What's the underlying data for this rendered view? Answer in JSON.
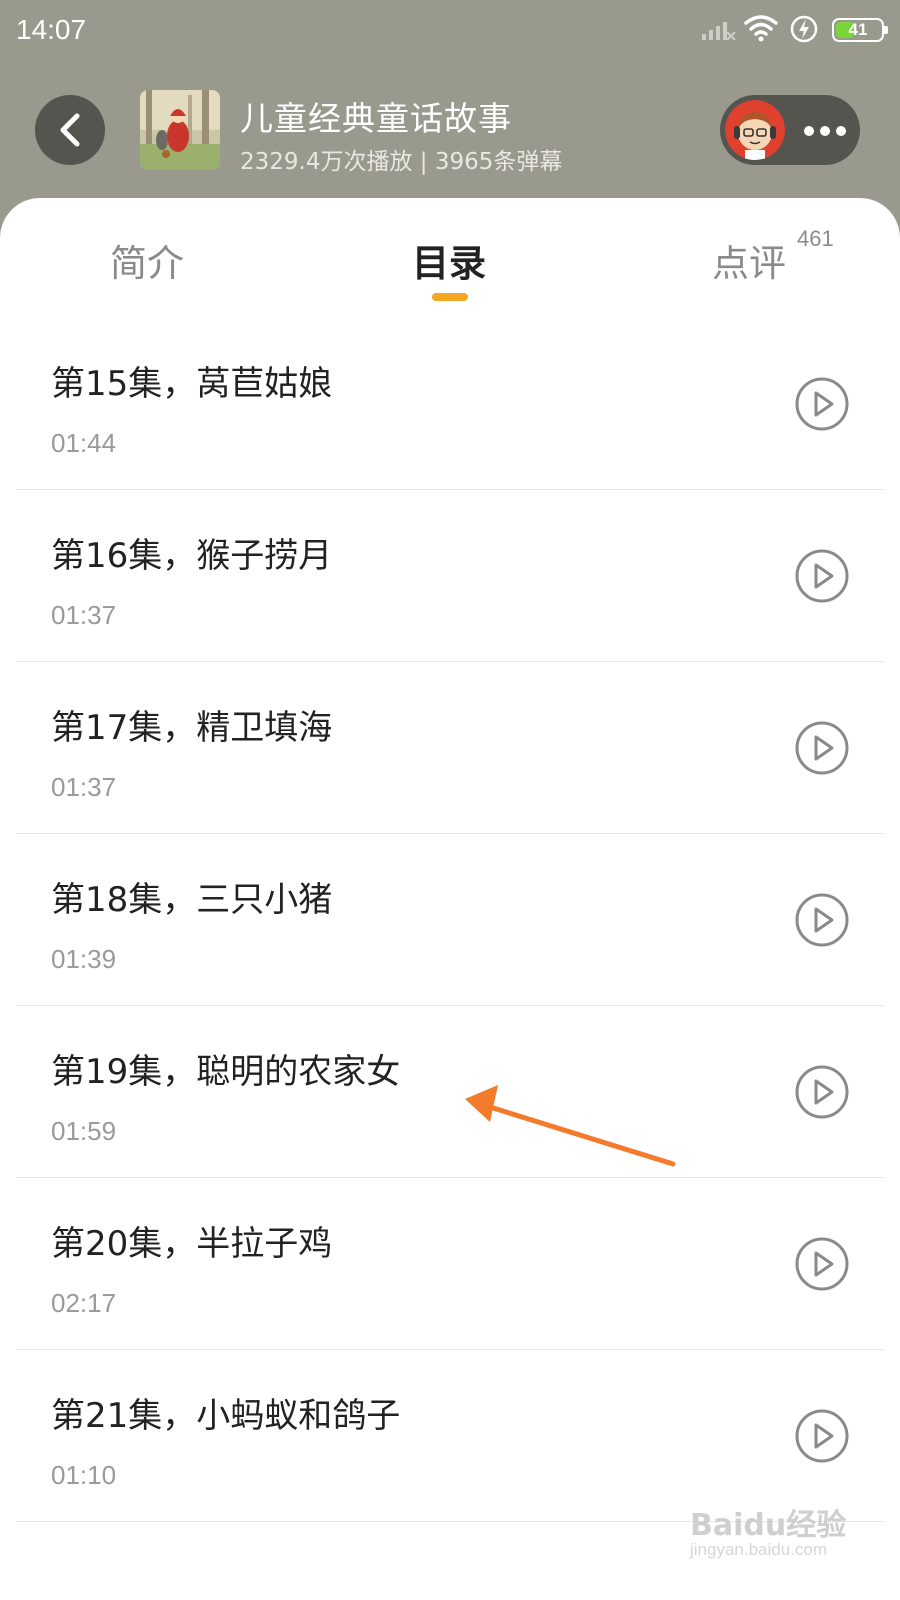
{
  "status_bar": {
    "time": "14:07",
    "battery_level": "41",
    "battery_fraction": 0.41
  },
  "header": {
    "title": "儿童经典童话故事",
    "stats": "2329.4万次播放 | 3965条弹幕"
  },
  "tabs": [
    {
      "label": "简介"
    },
    {
      "label": "目录"
    },
    {
      "label": "点评",
      "badge": "461"
    }
  ],
  "active_tab": "目录",
  "episodes": [
    {
      "title": "第15集，莴苣姑娘",
      "duration": "01:44"
    },
    {
      "title": "第16集，猴子捞月",
      "duration": "01:37"
    },
    {
      "title": "第17集，精卫填海",
      "duration": "01:37"
    },
    {
      "title": "第18集，三只小猪",
      "duration": "01:39"
    },
    {
      "title": "第19集，聪明的农家女",
      "duration": "01:59"
    },
    {
      "title": "第20集，半拉子鸡",
      "duration": "02:17"
    },
    {
      "title": "第21集，小蚂蚁和鸽子",
      "duration": "01:10"
    }
  ],
  "watermark": {
    "brand": "Baidu经验",
    "url": "jingyan.baidu.com"
  },
  "colors": {
    "accent": "#f5a623",
    "header_bg": "#9a998e",
    "arrow": "#f47a2c"
  },
  "icons": [
    "back-icon",
    "more-icon",
    "play-icon",
    "wifi-icon",
    "signal-icon",
    "charge-icon"
  ]
}
